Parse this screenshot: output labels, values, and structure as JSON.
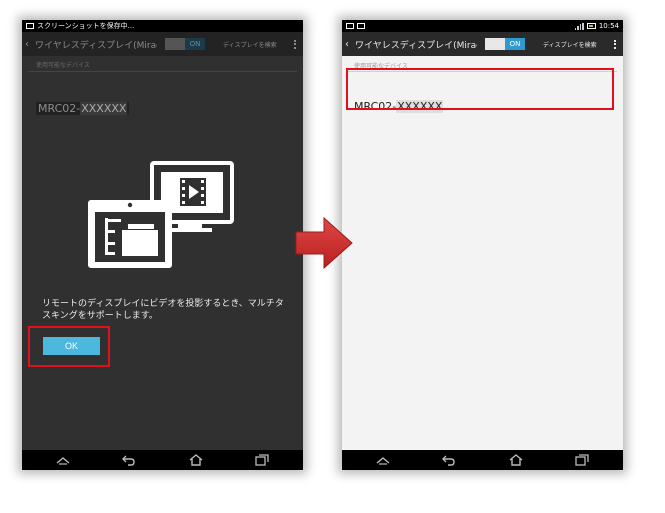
{
  "left_screen": {
    "status": {
      "notification_text": "スクリーンショットを保存中..."
    },
    "actionbar": {
      "title": "ワイヤレスディスプレイ(Mirac...",
      "toggle_label": "ON",
      "action_label": "ディスプレイを検索"
    },
    "section_label": "使用可能なデバイス",
    "device": {
      "prefix": "MRC02-",
      "suffix": "XXXXXX"
    },
    "description": "リモートのディスプレイにビデオを投影するとき、マルチタスキングをサポートします。",
    "ok_label": "OK"
  },
  "right_screen": {
    "status": {
      "time": "10:54"
    },
    "actionbar": {
      "title": "ワイヤレスディスプレイ(Mirac...",
      "toggle_label": "ON",
      "action_label": "ディスプレイを検索"
    },
    "section_label": "使用可能なデバイス",
    "device": {
      "prefix": "MRC02-",
      "suffix": "XXXXXX"
    }
  },
  "colors": {
    "highlight": "#e0101f",
    "ok_button": "#4cb8de",
    "toggle_on": "#2f9ad0",
    "arrow": "#d32a2a"
  },
  "icons": {
    "navbar": [
      "home-up-icon",
      "back-icon",
      "home-icon",
      "recent-apps-icon"
    ],
    "illustration": "multi-screen-video-icon",
    "transition": "right-arrow-icon"
  }
}
